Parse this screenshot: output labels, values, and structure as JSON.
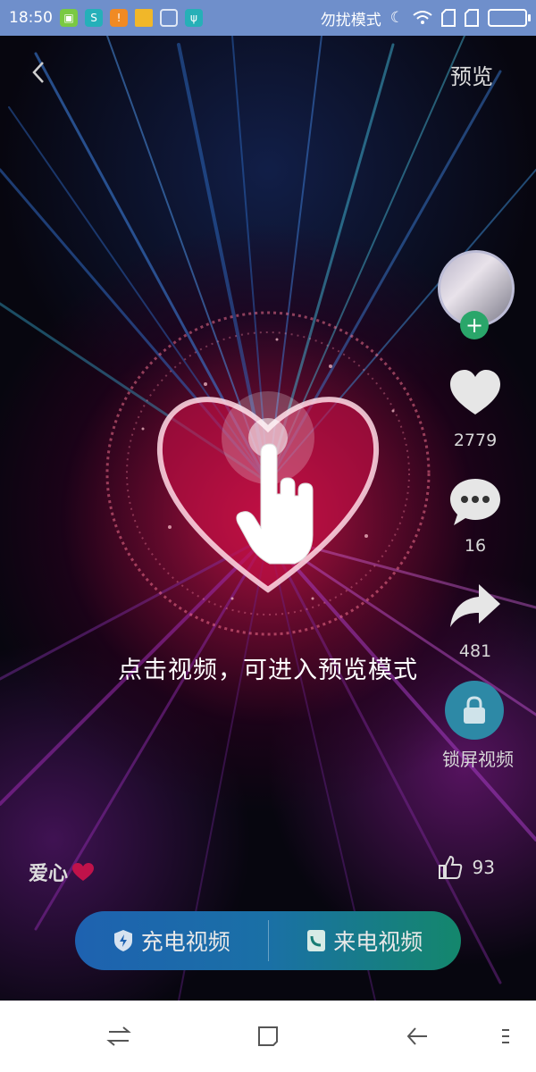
{
  "status_bar": {
    "time": "18:50",
    "dnd_label": "勿扰模式",
    "notification_icons": [
      "android-app-icon",
      "recycle-app-icon",
      "warning-icon",
      "folder-icon",
      "broom-icon",
      "usb-icon"
    ],
    "notification_colors": [
      "#7ac943",
      "#25b0b9",
      "#f08a24",
      "#f1b729",
      "#8fa6d6",
      "#26b0b7"
    ]
  },
  "top": {
    "preview_label": "预览"
  },
  "hint_text": "点击视频，可进入预览模式",
  "rail": {
    "like_count": "2779",
    "comment_count": "16",
    "share_count": "481",
    "lock_label": "锁屏视频"
  },
  "video": {
    "title": "爱心",
    "like_count": "93"
  },
  "bottom_buttons": {
    "charge_label": "充电视频",
    "call_label": "来电视频"
  },
  "colors": {
    "status_bar": "#6f8fcb",
    "follow_green": "#2aa66a",
    "lock_blue": "#2d89a6",
    "heart_red": "#c0124a"
  }
}
